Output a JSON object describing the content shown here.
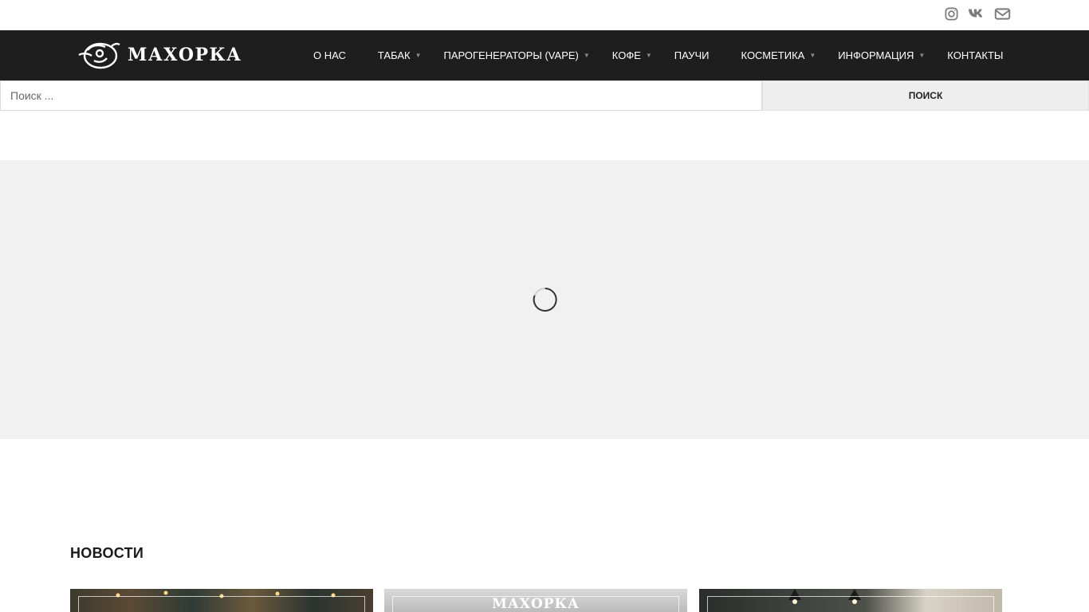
{
  "social": {
    "icons": [
      "instagram-icon",
      "vk-icon",
      "envelope-icon"
    ],
    "color": "#7a7a7a"
  },
  "header": {
    "logo_text": "МАХОРКА",
    "background": "#1e1e1e"
  },
  "menu": {
    "items": [
      {
        "label": "О НАС",
        "has_submenu": false
      },
      {
        "label": "ТАБАК",
        "has_submenu": true
      },
      {
        "label": "ПАРОГЕНЕРАТОРЫ (VAPE)",
        "has_submenu": true
      },
      {
        "label": "КОФЕ",
        "has_submenu": true
      },
      {
        "label": "ПАУЧИ",
        "has_submenu": false
      },
      {
        "label": "КОСМЕТИКА",
        "has_submenu": true
      },
      {
        "label": "ИНФОРМАЦИЯ",
        "has_submenu": true
      },
      {
        "label": "КОНТАКТЫ",
        "has_submenu": false
      }
    ],
    "arrow_glyph": "▼"
  },
  "search": {
    "placeholder": "Поиск ...",
    "value": "",
    "button_label": "ПОИСК"
  },
  "slider": {
    "state": "loading"
  },
  "news": {
    "title": "НОВОСТИ",
    "cards": [
      {
        "image": "shop-interior-lights"
      },
      {
        "image": "makhorka-storefront",
        "logo_text": "МАХОРКА"
      },
      {
        "image": "shop-interior-lamps"
      }
    ]
  }
}
